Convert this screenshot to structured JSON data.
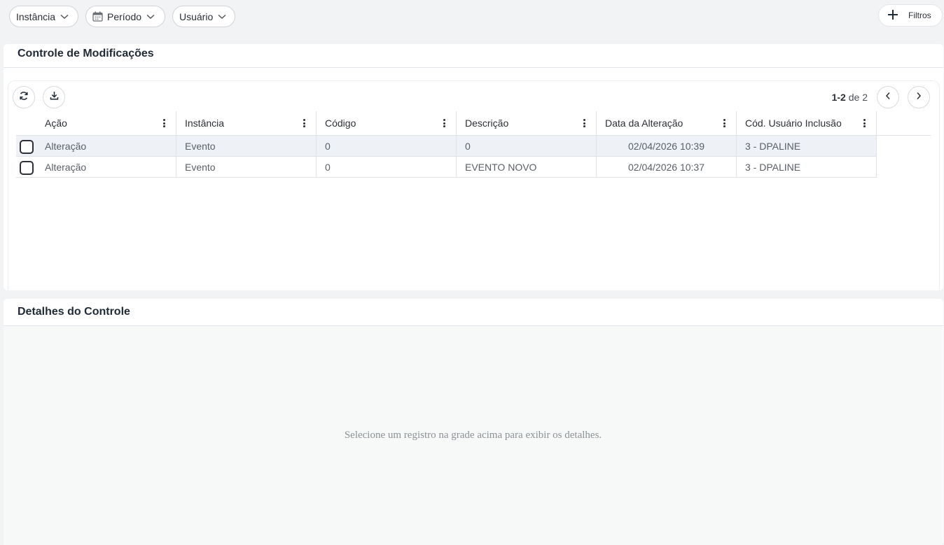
{
  "filters": {
    "instancia_label": "Instância",
    "periodo_label": "Período",
    "usuario_label": "Usuário",
    "filtros_label": "Filtros"
  },
  "controle": {
    "title": "Controle de Modificações",
    "pager": {
      "range": "1-2",
      "of_label": "de",
      "total": "2"
    },
    "columns": [
      "Ação",
      "Instância",
      "Código",
      "Descrição",
      "Data da Alteração",
      "Cód. Usuário Inclusão"
    ],
    "rows": [
      {
        "acao": "Alteração",
        "instancia": "Evento",
        "codigo": "0",
        "descricao": "0",
        "data": "02/04/2026 10:39",
        "usuario": "3 - DPALINE"
      },
      {
        "acao": "Alteração",
        "instancia": "Evento",
        "codigo": "0",
        "descricao": "EVENTO NOVO",
        "data": "02/04/2026 10:37",
        "usuario": "3 - DPALINE"
      }
    ]
  },
  "detalhes": {
    "title": "Detalhes do Controle",
    "empty_message": "Selecione um registro na grade acima para exibir os detalhes."
  },
  "colors": {
    "page_bg": "#f2f3f5",
    "selected_row": "#eef1f5",
    "title_text": "#1f2a37"
  }
}
